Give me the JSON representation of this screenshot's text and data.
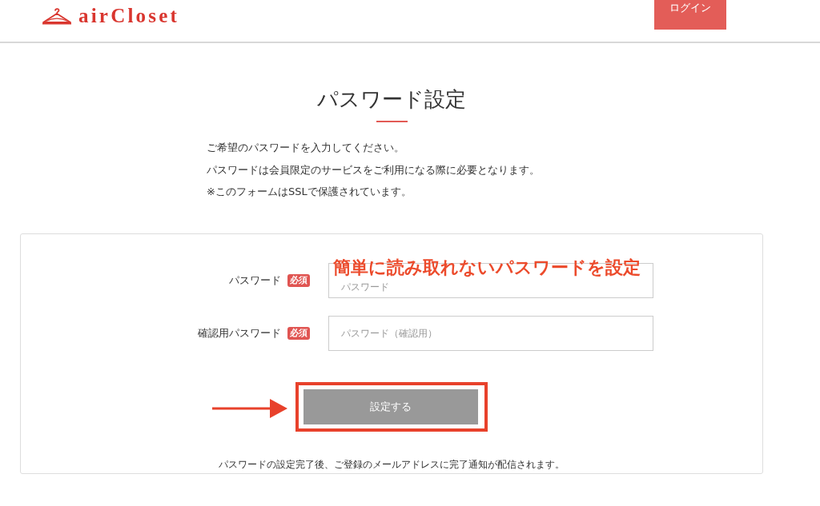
{
  "header": {
    "logo": "airCloset",
    "login_button": "ログイン"
  },
  "page": {
    "title": "パスワード設定",
    "intro": [
      "ご希望のパスワードを入力してください。",
      "パスワードは会員限定のサービスをご利用になる際に必要となります。",
      "※このフォームはSSLで保護されています。"
    ]
  },
  "form": {
    "fields": [
      {
        "label": "パスワード",
        "badge": "必須",
        "placeholder": "パスワード",
        "callout": "簡単に読み取れないパスワードを設定"
      },
      {
        "label": "確認用パスワード",
        "badge": "必須",
        "placeholder": "パスワード（確認用）"
      }
    ],
    "submit": {
      "label": "設定する",
      "highlighted": true
    },
    "note": "パスワードの設定完了後、ご登録のメールアドレスに完了通知が配信されます。"
  }
}
